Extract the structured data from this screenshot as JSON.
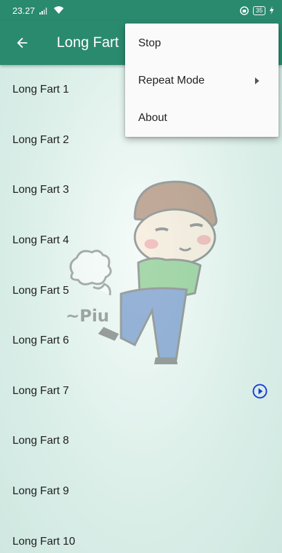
{
  "status_bar": {
    "time": "23.27",
    "battery": "35"
  },
  "app_bar": {
    "title": "Long Fart",
    "back_icon": "arrow-left-icon"
  },
  "list": {
    "items": [
      {
        "label": "Long Fart 1"
      },
      {
        "label": "Long Fart 2"
      },
      {
        "label": "Long Fart 3"
      },
      {
        "label": "Long Fart 4"
      },
      {
        "label": "Long Fart 5"
      },
      {
        "label": "Long Fart 6"
      },
      {
        "label": "Long Fart 7",
        "playing": true
      },
      {
        "label": "Long Fart 8"
      },
      {
        "label": "Long Fart 9"
      },
      {
        "label": "Long Fart 10"
      }
    ]
  },
  "menu": {
    "items": [
      {
        "label": "Stop"
      },
      {
        "label": "Repeat Mode",
        "has_submenu": true
      },
      {
        "label": "About"
      }
    ]
  },
  "illustration": {
    "caption": "~Piu"
  },
  "colors": {
    "primary": "#2a8a6e",
    "accent": "#1a3fd6",
    "background": "#dcefe9"
  }
}
